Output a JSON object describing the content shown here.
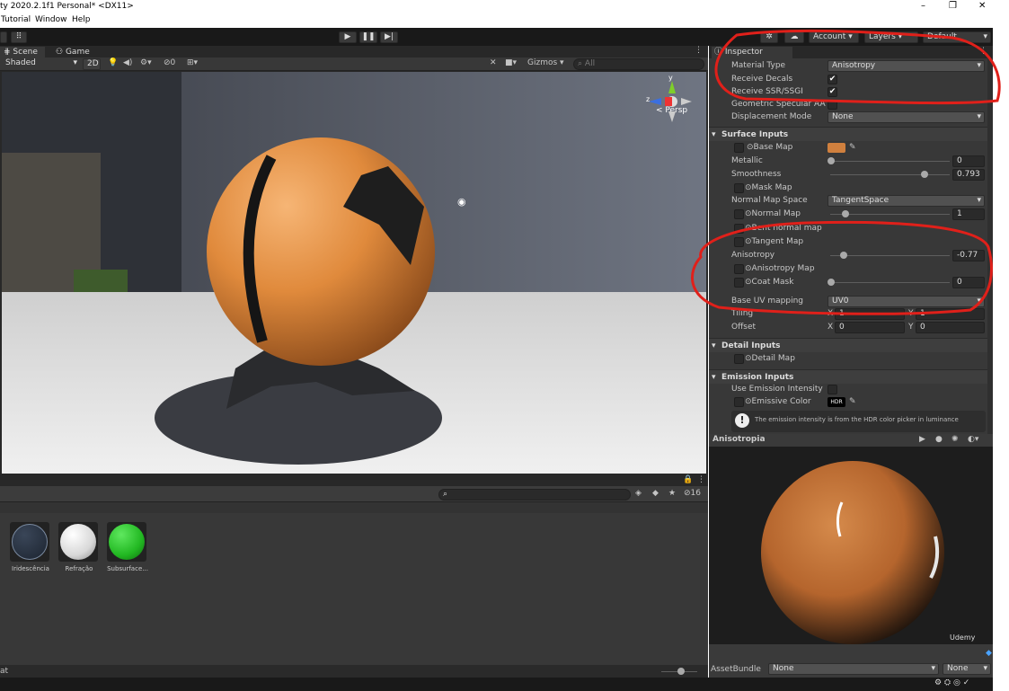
{
  "window": {
    "title": "ty 2020.2.1f1 Personal* <DX11>",
    "controls": {
      "minimize": "–",
      "maximize": "❐",
      "close": "✕"
    }
  },
  "menu": [
    "Tutorial",
    "Window",
    "Help"
  ],
  "toolbar": {
    "account_label": "Account",
    "layers_label": "Layers",
    "layout_label": "Default"
  },
  "scene_view": {
    "tabs": [
      "Scene",
      "Game"
    ],
    "shading_mode": "Shaded",
    "mode_2d": "2D",
    "fx_count": "0",
    "gizmos_label": "Gizmos",
    "search_placeholder": "All",
    "persp_label": "< Persp",
    "gizmo_axes": {
      "y": "y",
      "z": "z"
    }
  },
  "inspector": {
    "title": "Inspector",
    "material_type_label": "Material Type",
    "material_type_value": "Anisotropy",
    "receive_decals_label": "Receive Decals",
    "receive_decals_checked": true,
    "receive_ssr_label": "Receive SSR/SSGI",
    "receive_ssr_checked": true,
    "geometric_specular_label": "Geometric Specular AA",
    "geometric_specular_checked": false,
    "displacement_label": "Displacement Mode",
    "displacement_value": "None",
    "surface_inputs_header": "Surface Inputs",
    "base_map_label": "Base Map",
    "base_color": "#d0803e",
    "metallic_label": "Metallic",
    "metallic_value": "0",
    "smoothness_label": "Smoothness",
    "smoothness_value": "0.793",
    "mask_map_label": "Mask Map",
    "normal_map_space_label": "Normal Map Space",
    "normal_map_space_value": "TangentSpace",
    "normal_map_label": "Normal Map",
    "normal_map_value": "1",
    "bent_normal_label": "Bent normal map",
    "tangent_map_label": "Tangent Map",
    "anisotropy_label": "Anisotropy",
    "anisotropy_value": "-0.77",
    "anisotropy_map_label": "Anisotropy Map",
    "coat_mask_label": "Coat Mask",
    "coat_mask_value": "0",
    "base_uv_label": "Base UV mapping",
    "base_uv_value": "UV0",
    "tiling_label": "Tiling",
    "tiling_x_label": "X",
    "tiling_x": "1",
    "tiling_y_label": "Y",
    "tiling_y": "1",
    "offset_label": "Offset",
    "offset_x_label": "X",
    "offset_x": "0",
    "offset_y_label": "Y",
    "offset_y": "0",
    "detail_inputs_header": "Detail Inputs",
    "detail_map_label": "Detail Map",
    "emission_inputs_header": "Emission Inputs",
    "use_emission_intensity_label": "Use Emission Intensity",
    "emissive_color_label": "Emissive Color",
    "hdr_label": "HDR",
    "emission_info": "The emission intensity is from the HDR color picker in luminance"
  },
  "preview": {
    "title": "Anisotropia",
    "watermark": "Udemy"
  },
  "project": {
    "search_placeholder": "",
    "hidden_count": "16",
    "materials": [
      {
        "name": "Iridescência",
        "color": "#1c2430"
      },
      {
        "name": "Refração",
        "color": "#d8d8d8"
      },
      {
        "name": "Subsurface...",
        "color": "#22b822"
      }
    ]
  },
  "status": {
    "text": "at"
  },
  "asset_bundle": {
    "label": "AssetBundle",
    "name_value": "None",
    "variant_value": "None"
  }
}
